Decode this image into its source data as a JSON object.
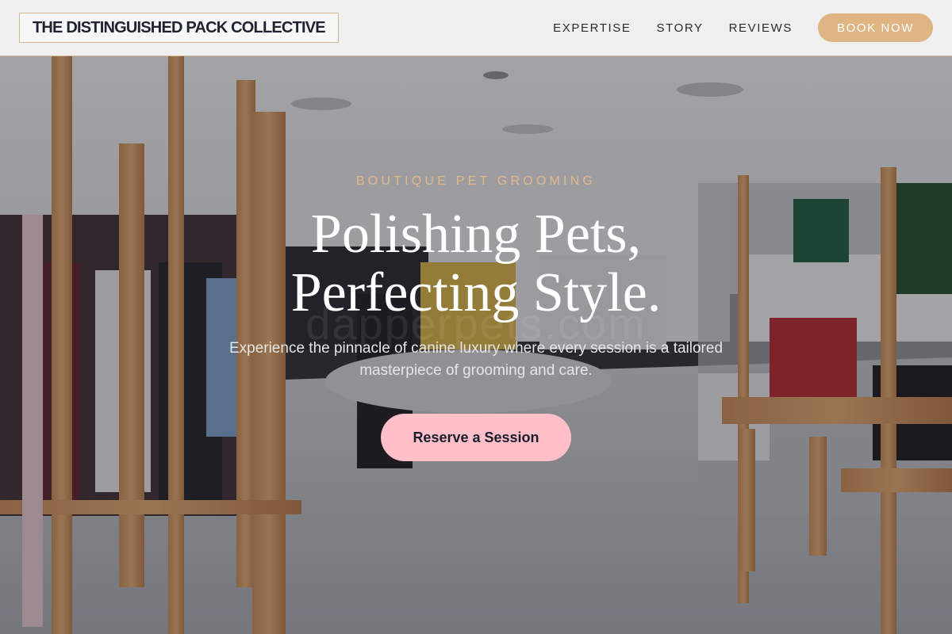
{
  "header": {
    "logo": "THE DISTINGUISHED PACK COLLECTIVE",
    "nav": [
      {
        "label": "EXPERTISE"
      },
      {
        "label": "STORY"
      },
      {
        "label": "REVIEWS"
      }
    ],
    "book_label": "BOOK NOW"
  },
  "hero": {
    "eyebrow": "BOUTIQUE PET GROOMING",
    "headline_line1": "Polishing Pets,",
    "headline_line2": "Perfecting Style.",
    "subhead": "Experience the pinnacle of canine luxury where every session is a tailored masterpiece of grooming and care.",
    "cta_label": "Reserve a Session",
    "watermark": "dapperpets.com"
  },
  "colors": {
    "accent_gold": "#dfb583",
    "cta_pink": "#ffbfc9",
    "header_bg": "#f0f0f0",
    "ink": "#1f2230"
  },
  "background_image": "boutique-store-interior"
}
